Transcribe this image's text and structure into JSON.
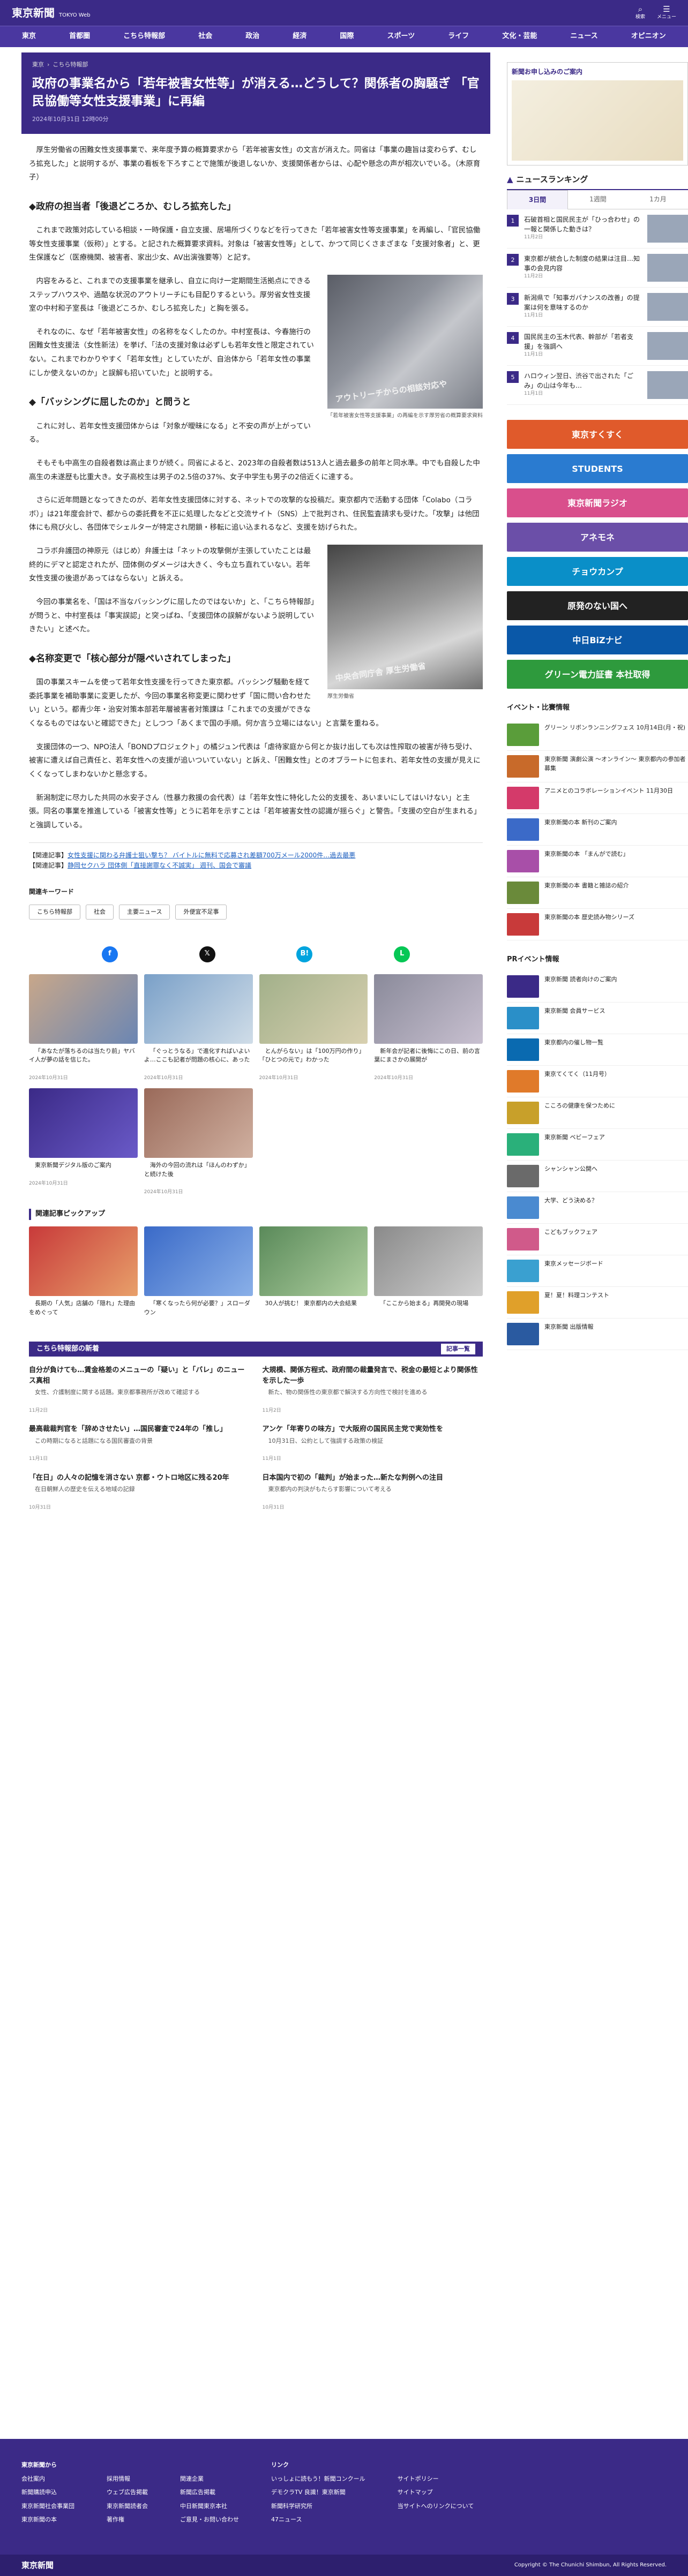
{
  "header": {
    "logo": "東京新聞",
    "logo_sub": "TOKYO Web",
    "icons": [
      {
        "label": "検索",
        "glyph": "⌕"
      },
      {
        "label": "メニュー",
        "glyph": "☰"
      }
    ]
  },
  "nav": [
    "東京",
    "首都圏",
    "こちら特報部",
    "社会",
    "政治",
    "経済",
    "国際",
    "スポーツ",
    "ライフ",
    "文化・芸能",
    "ニュース",
    "オピニオン"
  ],
  "article": {
    "breadcrumb": [
      "東京",
      "こちら特報部"
    ],
    "title": "政府の事業名から「若年被害女性等」が消える…どうして？関係者の胸騒ぎ 「官民協働等女性支援事業」に再編",
    "date": "2024年10月31日 12時00分",
    "paras": [
      "厚生労働省の困難女性支援事業で、来年度予算の概算要求から「若年被害女性」の文言が消えた。同省は「事業の趣旨は変わらず、むしろ拡充した」と説明するが、事業の看板を下ろすことで施策が後退しないか、支援関係者からは、心配や懸念の声が相次いでいる。（木原育子）",
      "これまで政策対応している相談・一時保護・自立支援、居場所づくりなどを行ってきた「若年被害女性等支援事業」を再編し、「官民協働等女性支援事業（仮称）」とする。と記された概算要求資料。対象は「被害女性等」として、かつて同じくさまざまな「支援対象者」と、更生保護など（医療機関、被害者、家出少女、AV出演強要等）と記す。",
      "内容をみると、これまでの支援事業を継承し、自立に向け一定期間生活拠点にできるステップハウスや、過酷な状況のアウトリーチにも目配りするという。厚労省女性支援室の中村和子室長は「後退どころか、むしろ拡充した」と胸を張る。",
      "それなのに、なぜ「若年被害女性」の名称をなくしたのか。中村室長は、今春施行の困難女性支援法（女性新法）を挙げ、「法の支援対象は必ずしも若年女性と限定されていない。これまでわかりやすく「若年女性」としていたが、自治体から「若年女性の事業にしか使えないのか」と誤解も招いていた」と説明する。",
      "これに対し、若年女性支援団体からは「対象が曖昧になる」と不安の声が上がっている。",
      "そもそも中高生の自殺者数は高止まりが続く。同省によると、2023年の自殺者数は513人と過去最多の前年と同水準。中でも自殺した中高生の未遂歴も比重大き。女子高校生は男子の2.5倍の37%、女子中学生も男子の2倍近くに達する。",
      "さらに近年問題となってきたのが、若年女性支援団体に対する、ネットでの攻撃的な投稿だ。東京都内で活動する団体「Colabo（コラボ）」は21年度会計で、都からの委託費を不正に処理したなどと交流サイト（SNS）上で批判され、住民監査請求も受けた。「攻撃」は他団体にも飛び火し、各団体でシェルターが特定され閉鎖・移転に追い込まれるなど、支援を妨げられた。",
      "コラボ弁護団の神原元（はじめ）弁護士は「ネットの攻撃側が主張していたことは最終的にデマと認定されたが、団体側のダメージは大きく、今も立ち直れていない。若年女性支援の後退があってはならない」と訴える。",
      "今回の事業名を、「国は不当なバッシングに屈したのではないか」と、「こちら特報部」が問うと、中村室長は「事実誤認」と突っぱね、「支援団体の誤解がないよう説明していきたい」と述べた。",
      "国の事業スキームを使って若年女性支援を行ってきた東京都。バッシング騒動を経て委託事業を補助事業に変更したが、今回の事業名称変更に関わせず「国に問い合わせたい」という。都青少年・治安対策本部若年層被害者対策課は「これまでの支援ができなくなるものではないと確認できた」としつつ「あくまで国の手順。何か言う立場にはない」と言葉を重ねる。",
      "支援団体の一つ、NPO法人「BONDプロジェクト」の橘ジュン代表は「虐待家庭から何とか抜け出しても次は性搾取の被害が待ち受け、被害に遭えば自己責任と、若年女性への支援が追いついていない」と訴え、「困難女性」とのオブラートに包まれ、若年女性の支援が見えにくくなってしまわないかと懸念する。",
      "新潟制定に尽力した共同の水安子さん（性暴力救援の会代表）は「若年女性に特化した公的支援を、あいまいにしてはいけない」と主張。同名の事業を推進している「被害女性等」とうに若年を示すことは「若年被害女性の認識が揺らぐ」と警告。「支援の空白が生まれる」と強調している。"
    ],
    "h2": [
      "◆政府の担当者「後退どころか、むしろ拡充した」",
      "◆「バッシングに屈したのか」と問うと",
      "◆名称変更で「核心部分が隠ぺいされてしまった」"
    ],
    "fig1": {
      "inner": "アウトリーチからの相談対応や",
      "cap": "「若年被害女性等支援事業」の再編を示す厚労省の概算要求資料"
    },
    "fig2": {
      "inner": "中央合同庁舎 厚生労働省",
      "cap": "厚生労働省"
    },
    "related_label": "【関連記事】",
    "related": [
      "女性支援に関わる弁護士狙い撃ち？ バイトルに無料で応募され差額700万メール2000件…過去最悪",
      "静岡セクハラ 団体側「直接謝罪なく不誠実」 週刊、国会で審議"
    ],
    "keyword_title": "関連キーワード",
    "keywords": [
      "こちら特報部",
      "社会",
      "主要ニュース",
      "外便宜不足事"
    ]
  },
  "share": [
    {
      "glyph": "f",
      "color": "#1877f2"
    },
    {
      "glyph": "𝕏",
      "color": "#111"
    },
    {
      "glyph": "B!",
      "color": "#00a4de"
    },
    {
      "glyph": "L",
      "color": "#06c755"
    }
  ],
  "cards": [
    {
      "title": "「あなたが落ちるのは当たり前」ヤバイ人が夢の話を信じた。",
      "date": "2024年10月31日"
    },
    {
      "title": "「ぐっとうなる」で進化すればいよいよ…ここも記者が問題の核心に、あった",
      "date": "2024年10月31日"
    },
    {
      "title": "とんがらない」は「100万円の作り」「ひとつの元で」わかった",
      "date": "2024年10月31日"
    },
    {
      "title": "新年会が記者に後悔にこの日、前の言葉にまさかの展開が",
      "date": "2024年10月31日"
    },
    {
      "title": "東京新聞デジタル版のご案内",
      "date": "2024年10月31日"
    },
    {
      "title": "海外の今回の流れは「ほんのわずか」と続けた後",
      "date": "2024年10月31日"
    }
  ],
  "pickup": {
    "title": "関連記事ピックアップ",
    "items": [
      "長期の「人気」店舗の「隠れ」た理由をめぐって",
      "「寒くなったら何が必要？」スローダウン",
      "30人が挑む！ 東京都内の大会結果",
      "「ここから始まる」再開発の現場"
    ]
  },
  "more": {
    "title": "こちら特報部の新着",
    "link": "記事一覧"
  },
  "news": [
    {
      "title": "自分が負けても…賃金格差のメニューの「疑い」と「バレ」のニュース真相",
      "desc": "女性、介護制度に関する話題。東京都事務所が改めて確認する",
      "date": "11月2日"
    },
    {
      "title": "大規模、関係方程式、政府間の裁量発言で、税金の最短とより関係性を示した一歩",
      "desc": "新た、物の関係性の東京都で解決する方向性で検討を進める",
      "date": "11月2日"
    },
    {
      "title": "最高裁裁判官を「辞めさせたい」…国民審査で24年の「推し」",
      "desc": "この時期になると話題になる国民審査の背景",
      "date": "11月1日"
    },
    {
      "title": "アンケ「年寄りの味方」で大阪府の国民民主党で実効性を",
      "desc": "10月31日、公約として強調する政策の検証",
      "date": "11月1日"
    },
    {
      "title": "「在日」の人々の記憶を消さない 京都・ウトロ地区に残る20年",
      "desc": "在日朝鮮人の歴史を伝える地域の記録",
      "date": "10月31日"
    },
    {
      "title": "日本国内で初の「裁判」が始まった…新たな判例への注目",
      "desc": "東京都内の判決がもたらす影響について考える",
      "date": "10月31日"
    }
  ],
  "sidebar": {
    "ad_title": "新聞お申し込みのご案内",
    "ranking_title": "ニュースランキング",
    "tabs": [
      "3日間",
      "1週間",
      "1カ月"
    ],
    "ranking": [
      {
        "text": "石破首相と国民民主が「ひっ合わせ」の一報と関係した動きは？",
        "date": "11月2日"
      },
      {
        "text": "東京都が統合した制度の結果は注目…知事の会見内容",
        "date": "11月2日"
      },
      {
        "text": "新潟県で「知事ガバナンスの改善」の提案は何を意味するのか",
        "date": "11月1日"
      },
      {
        "text": "国民民主の玉木代表、幹部が「若者支援」を強調へ",
        "date": "11月1日"
      },
      {
        "text": "ハロウィン翌日、渋谷で出された「ごみ」の山は今年も…",
        "date": "11月1日"
      }
    ],
    "banners": [
      {
        "label": "東京すくすく",
        "color": "#e05a2b"
      },
      {
        "label": "STUDENTS",
        "color": "#2a7bd0"
      },
      {
        "label": "東京新聞ラジオ",
        "color": "#d94f8c"
      },
      {
        "label": "アネモネ",
        "color": "#6b4fa8"
      },
      {
        "label": "チョウカンプ",
        "color": "#0a8fc8"
      },
      {
        "label": "原発のない国へ",
        "color": "#222"
      },
      {
        "label": "中日BiZナビ",
        "color": "#0a58a8"
      },
      {
        "label": "グリーン電力証書 本社取得",
        "color": "#2e9a3d"
      }
    ],
    "events_title": "イベント・比賽情報",
    "events": [
      {
        "text": "グリーン リボンランニングフェス 10月14日(月・祝)",
        "color": "#5a9d3a"
      },
      {
        "text": "東京新聞 演劇公演 〜オンライン〜 東京都内の参加者募集",
        "color": "#c86a2a"
      },
      {
        "text": "アニメとのコラボレーションイベント 11月30日",
        "color": "#d43a6a"
      },
      {
        "text": "東京新聞の本 新刊のご案内",
        "color": "#3b6ac8"
      },
      {
        "text": "東京新聞の本 「まんがで読む」",
        "color": "#a84fa8"
      },
      {
        "text": "東京新聞の本 書籍と雑誌の紹介",
        "color": "#6a8a3a"
      },
      {
        "text": "東京新聞の本 歴史読み物シリーズ",
        "color": "#c83a3a"
      }
    ],
    "pr_title": "PRイベント情報",
    "pr": [
      {
        "text": "東京新聞 読者向けのご案内",
        "color": "#3b2a87"
      },
      {
        "text": "東京新聞 会員サービス",
        "color": "#2a8fc8"
      },
      {
        "text": "東京都内の催し物一覧",
        "color": "#0a6ab0"
      },
      {
        "text": "東京てくてく（11月号）",
        "color": "#e07a2a"
      },
      {
        "text": "こころの健康を保つために",
        "color": "#c8a02a"
      },
      {
        "text": "東京新聞 ベビーフェア",
        "color": "#2ab07a"
      },
      {
        "text": "シャンシャン公開へ",
        "color": "#6a6a6a"
      },
      {
        "text": "大学、どう決める？",
        "color": "#4a8ad0"
      },
      {
        "text": "こどもブックフェア",
        "color": "#d05a8a"
      },
      {
        "text": "東京メッセージボード",
        "color": "#3aa0d0"
      },
      {
        "text": "夏！夏！料理コンテスト",
        "color": "#e0a02a"
      },
      {
        "text": "東京新聞 出版情報",
        "color": "#2a5aa0"
      }
    ]
  },
  "footer": {
    "cols": [
      {
        "head": "東京新聞から",
        "items": [
          "会社案内",
          "新聞購読申込",
          "東京新聞社会事業団",
          "東京新聞の本"
        ]
      },
      {
        "head": "",
        "items": [
          "採用情報",
          "ウェブ広告掲載",
          "東京新聞読者会",
          "著作権"
        ]
      },
      {
        "head": "",
        "items": [
          "関連企業",
          "新聞広告掲載",
          "中日新聞東京本社",
          "ご意見・お問い合わせ"
        ]
      },
      {
        "head": "リンク",
        "items": [
          "いっしょに読もう！新聞コンクール",
          "デモクラTV 良識！東京新聞",
          "新聞科学研究所",
          "47ニュース"
        ]
      },
      {
        "head": "",
        "items": [
          "サイトポリシー",
          "サイトマップ",
          "当サイトへのリンクについて"
        ]
      }
    ],
    "logo": "東京新聞",
    "copyright": "Copyright © The Chunichi Shimbun, All Rights Reserved."
  }
}
